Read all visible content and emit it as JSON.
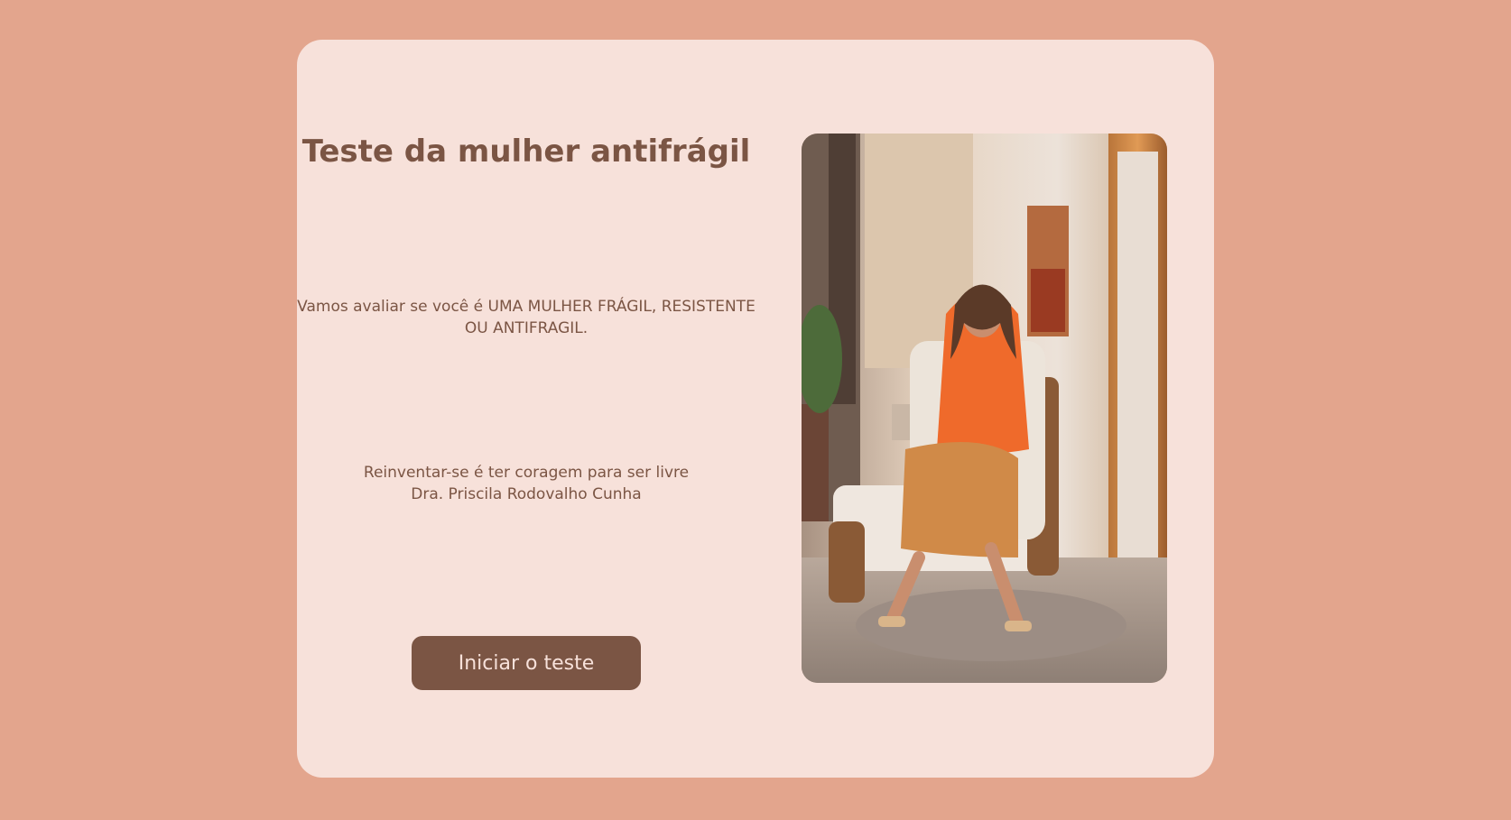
{
  "hero": {
    "title": "Teste da mulher antifrágil",
    "subtitle": "Vamos avaliar se você é UMA MULHER FRÁGIL, RESISTENTE OU ANTIFRAGIL.",
    "quote_line1": "Reinventar-se é ter coragem para ser livre",
    "quote_line2": "Dra. Priscila Rodovalho Cunha",
    "start_button_label": "Iniciar o teste"
  },
  "colors": {
    "page_background": "#e3a58d",
    "card_background": "#f7e1da",
    "accent": "#7b5544"
  },
  "photo": {
    "alt": "Woman in orange blouse seated in armchair"
  }
}
